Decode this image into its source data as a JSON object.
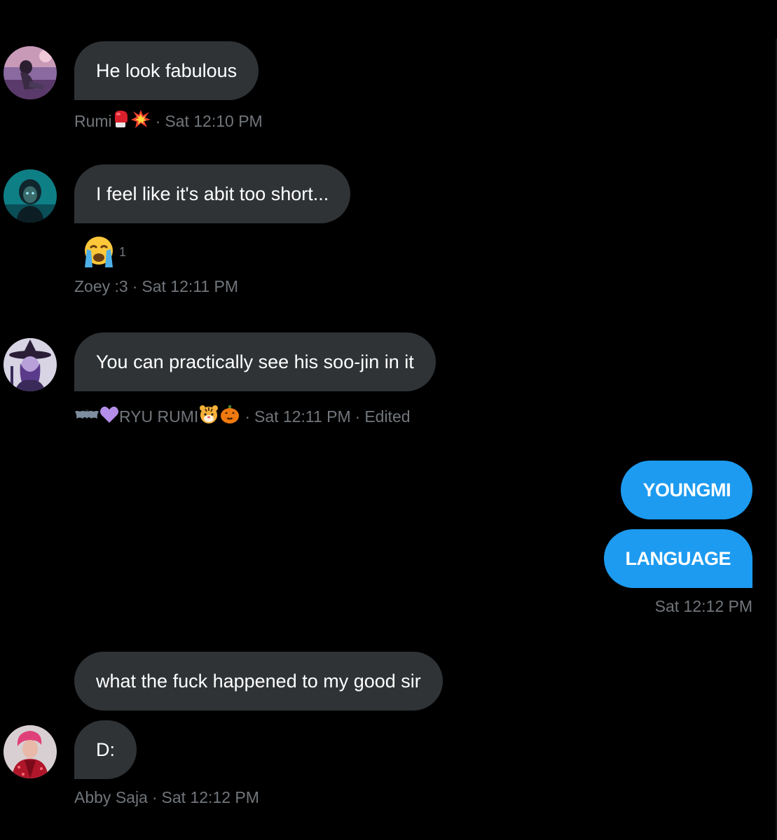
{
  "messages": [
    {
      "sender": "Rumi",
      "text": "He look fabulous",
      "time": "Sat 12:10 PM"
    },
    {
      "sender": "Zoey :3",
      "text": "I feel like it's abit too short...",
      "time": "Sat 12:11 PM",
      "reaction": {
        "emoji": "loudly-crying-face",
        "count": "1"
      }
    },
    {
      "sender": "RYU RUMI",
      "text": "You can practically see his soo-jin in it",
      "time": "Sat 12:11 PM",
      "edited": "Edited"
    },
    {
      "sender": "",
      "text": "YOUNGMI"
    },
    {
      "sender": "",
      "text": "LANGUAGE",
      "time": "Sat 12:12 PM"
    },
    {
      "sender": "Abby Saja",
      "text": "what the fuck happened to my good sir"
    },
    {
      "sender": "Abby Saja",
      "text": "D:",
      "time": "Sat 12:12 PM"
    }
  ],
  "separator": "·",
  "colors": {
    "background": "#000000",
    "incoming_bubble": "#2f3336",
    "outgoing_bubble": "#1d9bf0",
    "meta_text": "#71767b"
  }
}
